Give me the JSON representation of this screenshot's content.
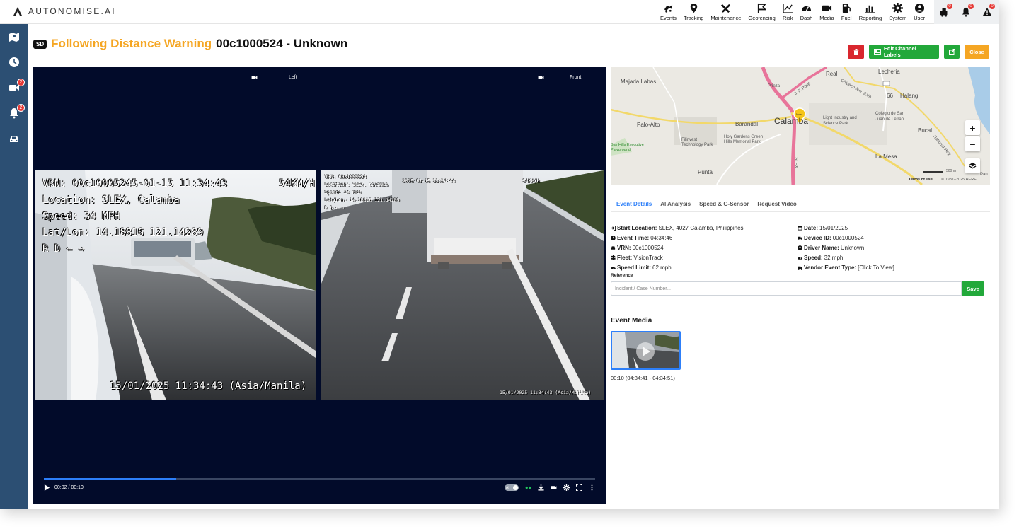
{
  "brand": {
    "name": "AUTONOMISE.AI"
  },
  "nav": [
    {
      "label": "Events",
      "icon": "events-icon"
    },
    {
      "label": "Tracking",
      "icon": "location-pin-icon"
    },
    {
      "label": "Maintenance",
      "icon": "tools-icon"
    },
    {
      "label": "Geofencing",
      "icon": "geofence-flag-icon"
    },
    {
      "label": "Risk",
      "icon": "line-chart-icon"
    },
    {
      "label": "Dash",
      "icon": "gauge-icon"
    },
    {
      "label": "Media",
      "icon": "video-camera-icon"
    },
    {
      "label": "Fuel",
      "icon": "fuel-pump-icon"
    },
    {
      "label": "Reporting",
      "icon": "bar-chart-icon"
    },
    {
      "label": "System",
      "icon": "gear-icon"
    },
    {
      "label": "User",
      "icon": "user-icon"
    }
  ],
  "alerts": [
    {
      "icon": "vehicle-alert-icon",
      "count": "0"
    },
    {
      "icon": "bell-icon",
      "count": "0"
    },
    {
      "icon": "warning-triangle-icon",
      "count": "0"
    }
  ],
  "sidebar": [
    {
      "icon": "map-people-icon",
      "badge": ""
    },
    {
      "icon": "clock-icon",
      "badge": ""
    },
    {
      "icon": "video-camera-icon",
      "badge": "2"
    },
    {
      "icon": "bell-icon",
      "badge": "2"
    },
    {
      "icon": "car-icon",
      "badge": ""
    }
  ],
  "header": {
    "badge": "SD",
    "event_type": "Following Distance Warning",
    "vehicle": "00c1000524 - Unknown"
  },
  "actions": {
    "edit_labels": "Edit Channel Labels",
    "close": "Close"
  },
  "video": {
    "cameras": {
      "left": "Left",
      "front": "Front"
    },
    "left_osd": {
      "line1": "VRN: 00c10005245-01-15 11:34:43",
      "speed_right": "54KM/H",
      "line2": "Location: SLEX, Calamba",
      "line3": "Speed: 34 MPH",
      "line4": "Lat/Lon: 14.18816 121.14289",
      "line5": "R D ⇐ ⇒",
      "timestamp": "15/01/2025 11:34:43 (Asia/Manila)"
    },
    "front_osd": {
      "line1": "VRN: 00c1000524",
      "line2": "Location: SLEX, Calamba",
      "line3": "Speed: 34 MPH",
      "line4": "Lat/Lon: 14.18816 121.14289",
      "line5": "R D ⇐ ⇒",
      "top_center": "2025-01-15 11:34:44",
      "top_right": "54KM/H",
      "timestamp": "15/01/2025 11:34:43 (Asia/Manila)"
    },
    "time": "00:02 / 00:10",
    "progress": 0.24,
    "ai_toggle": "AI"
  },
  "map": {
    "labels": {
      "majada": "Majada Labas",
      "real": "Real",
      "lecheria": "Lecheria",
      "prinza": "Prinza",
      "jp_rizal": "J. P. Rizal",
      "chipeco": "Chipeco Ave. Extn",
      "halang": "Halang",
      "palo_alto": "Palo-Alto",
      "barandal": "Barandal",
      "calamba": "Calamba",
      "light_industry": "Light Industry and Science Park",
      "colegio": "Colegio de San Juan de Letran",
      "bucal": "Bucal",
      "filinvest": "Filinvest Technology Park",
      "holy_gardens": "Holy Gardens Green Hills Memorial Park",
      "bay_hills": "Bay Hills Executive Playground",
      "national_hwy": "National Hwy",
      "slex": "SLEX",
      "la_mesa": "La Mesa",
      "punta": "Punta",
      "pan": "Pan",
      "route": "66",
      "scale": "500 m",
      "terms": "Terms of use",
      "copyright": "© 1987–2025 HERE",
      "marker": "Now"
    }
  },
  "tabs": [
    "Event Details",
    "AI Analysis",
    "Speed & G-Sensor",
    "Request Video"
  ],
  "details": {
    "start_location_label": "Start Location:",
    "start_location": "SLEX, 4027 Calamba, Philippines",
    "date_label": "Date:",
    "date": "15/01/2025",
    "event_time_label": "Event Time:",
    "event_time": "04:34:46",
    "device_id_label": "Device ID:",
    "device_id": "00c1000524",
    "vrn_label": "VRN:",
    "vrn": "00c1000524",
    "driver_label": "Driver Name:",
    "driver": "Unknown",
    "fleet_label": "Fleet:",
    "fleet": "VisionTrack",
    "speed_label": "Speed:",
    "speed": "32 mph",
    "speed_limit_label": "Speed Limit:",
    "speed_limit": "62 mph",
    "vendor_label": "Vendor Event Type:",
    "vendor": "[Click To View]"
  },
  "reference": {
    "label": "Reference",
    "placeholder": "Incident / Case Number...",
    "save": "Save"
  },
  "media": {
    "title": "Event Media",
    "caption": "00:10 (04:34:41 - 04:34:51)"
  }
}
